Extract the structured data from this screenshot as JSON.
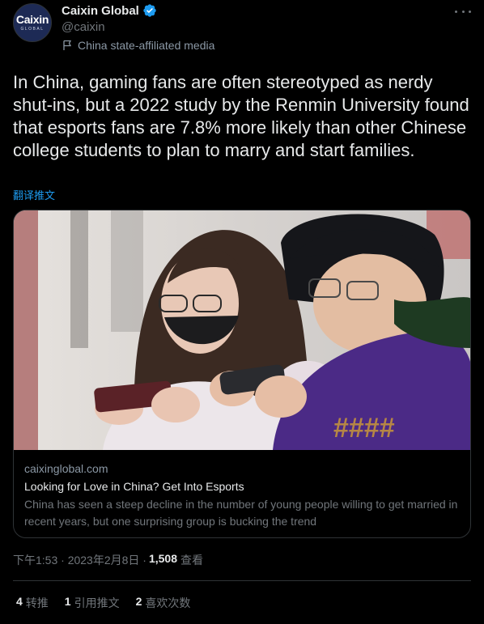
{
  "author": {
    "display_name": "Caixin Global",
    "handle": "@caixin",
    "affiliation": "China state-affiliated media",
    "avatar_logo": "Caixin",
    "avatar_sub": "GLOBAL",
    "verified_icon": "verified-badge-icon",
    "verified_color": "#1d9bf0"
  },
  "tweet": {
    "text": "In China, gaming fans are often stereotyped as nerdy shut-ins, but a 2022 study by the Renmin University found that esports fans are 7.8% more likely than other Chinese college students to plan to marry and start families.",
    "translate_label": "翻译推文"
  },
  "card": {
    "domain": "caixinglobal.com",
    "title": "Looking for Love in China? Get Into Esports",
    "description": "China has seen a steep decline in the number of young people willing to get married in recent years, but one surprising group is bucking the trend"
  },
  "meta": {
    "time": "下午1:53 · 2023年2月8日 ·",
    "views_count": "1,508",
    "views_label": "查看"
  },
  "stats": {
    "retweets_count": "4",
    "retweets_label": "转推",
    "quotes_count": "1",
    "quotes_label": "引用推文",
    "likes_count": "2",
    "likes_label": "喜欢次数"
  },
  "colors": {
    "background": "#000000",
    "text": "#e7e9ea",
    "secondary": "#71767b",
    "link": "#1d9bf0",
    "border": "#2f3336"
  }
}
